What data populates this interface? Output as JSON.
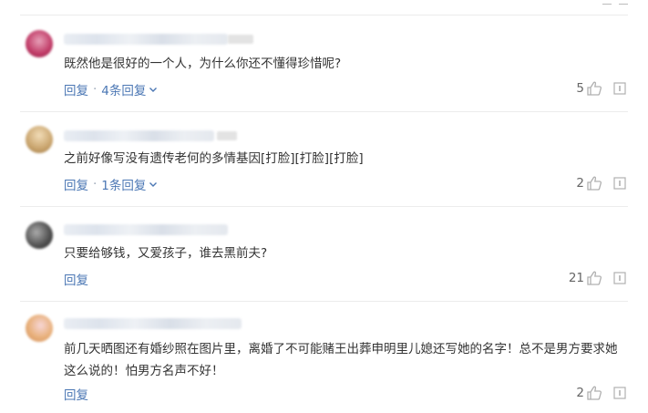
{
  "comments": [
    {
      "text": "既然他是很好的一个人，为什么你还不懂得珍惜呢?",
      "reply_label": "回复",
      "reply_count_label": "4条回复",
      "likes": "5",
      "avatar_color": "#c03a66"
    },
    {
      "text": "之前好像写没有遗传老何的多情基因[打脸][打脸][打脸]",
      "reply_label": "回复",
      "reply_count_label": "1条回复",
      "likes": "2",
      "avatar_color": "#c9a46d"
    },
    {
      "text": "只要给够钱，又爱孩子，谁去黑前夫?",
      "reply_label": "回复",
      "likes": "21",
      "avatar_color": "#555555"
    },
    {
      "text": "前几天晒图还有婚纱照在图片里，离婚了不可能赌王出葬申明里儿媳还写她的名字！总不是男方要求她这么说的！怕男方名声不好！",
      "reply_label": "回复",
      "likes": "2",
      "avatar_color": "#e8b07a"
    }
  ],
  "icons": {
    "like": "thumbs-up-icon",
    "more": "more-options-icon",
    "expand": "chevron-down-icon"
  },
  "colors": {
    "link": "#4b77b4",
    "divider": "#ececec",
    "icon": "#b0b0b0"
  }
}
